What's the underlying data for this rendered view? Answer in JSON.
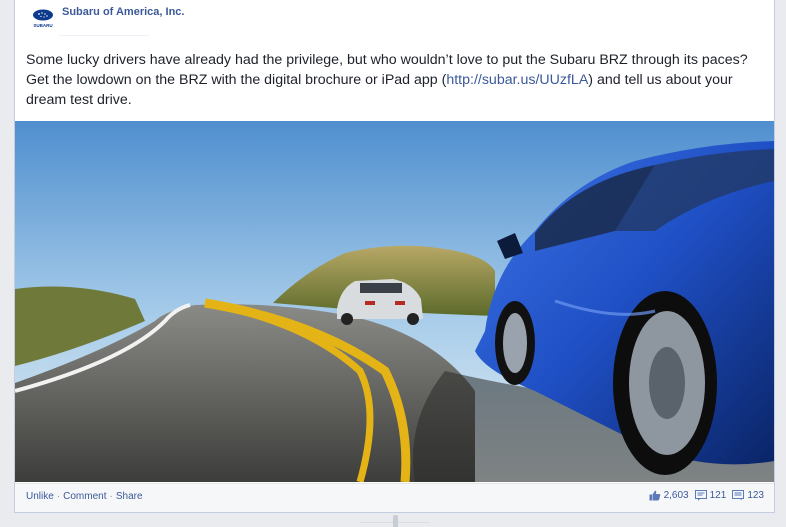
{
  "post": {
    "author": "Subaru of America, Inc.",
    "avatar_text": "SUBARU",
    "text_before_link": "Some lucky drivers have already had the privilege, but who wouldn’t love to put the Subaru BRZ through its paces? Get the lowdown on the BRZ with the digital brochure or iPad app (",
    "link_text": "http://subar.us/UUzfLA",
    "text_after_link": ") and tell us about your dream test drive."
  },
  "actions": {
    "unlike": "Unlike",
    "comment": "Comment",
    "share": "Share",
    "separator": "·"
  },
  "stats": {
    "likes": "2,603",
    "shares": "121",
    "comments": "123"
  },
  "icons": {
    "like": "thumbs-up-icon",
    "share": "share-icon",
    "comment": "comment-bubble-icon"
  },
  "colors": {
    "link": "#3b5998",
    "car": "#1f4fc4",
    "sky": "#bcd6ee"
  }
}
